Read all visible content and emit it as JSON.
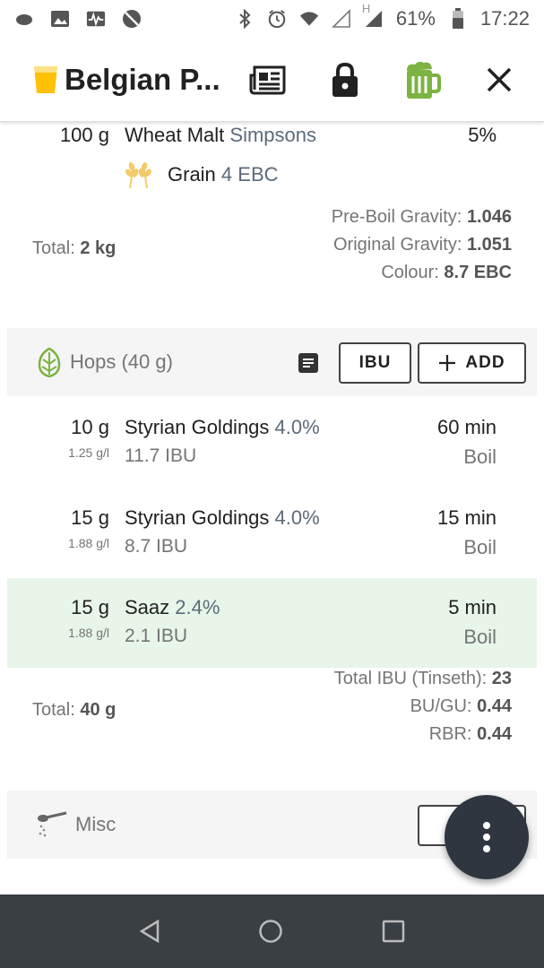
{
  "status_bar": {
    "battery": "61%",
    "time": "17:22",
    "network_h": "H",
    "icons_left": [
      "cloud-icon",
      "image-icon",
      "activity-icon",
      "no-sync-icon"
    ],
    "icons_right": [
      "bluetooth-icon",
      "alarm-icon",
      "wifi-icon",
      "signal-empty-icon",
      "signal-icon",
      "battery-icon"
    ]
  },
  "toolbar": {
    "title": "Belgian P...",
    "icons": [
      "beer-glass-icon",
      "newspaper-icon",
      "lock-icon",
      "beer-mug-icon",
      "close-icon"
    ]
  },
  "fermentables": {
    "last_item": {
      "quantity": "100 g",
      "name": "Wheat Malt",
      "supplier": "Simpsons",
      "percent": "5%",
      "type": "Grain",
      "colour": "4 EBC"
    },
    "total_label": "Total:",
    "total_value": "2 kg",
    "stats": [
      {
        "label": "Pre-Boil Gravity:",
        "value": "1.046"
      },
      {
        "label": "Original Gravity:",
        "value": "1.051"
      },
      {
        "label": "Colour:",
        "value": "8.7 EBC"
      }
    ]
  },
  "hops": {
    "header": "Hops (40 g)",
    "ibu_button": "IBU",
    "add_button": "ADD",
    "items": [
      {
        "quantity": "10 g",
        "concentration": "1.25 g/l",
        "name": "Styrian Goldings",
        "alpha": "4.0%",
        "ibu": "11.7 IBU",
        "time": "60 min",
        "use": "Boil"
      },
      {
        "quantity": "15 g",
        "concentration": "1.88 g/l",
        "name": "Styrian Goldings",
        "alpha": "4.0%",
        "ibu": "8.7 IBU",
        "time": "15 min",
        "use": "Boil"
      },
      {
        "quantity": "15 g",
        "concentration": "1.88 g/l",
        "name": "Saaz",
        "alpha": "2.4%",
        "ibu": "2.1 IBU",
        "time": "5 min",
        "use": "Boil"
      }
    ],
    "total_label": "Total:",
    "total_value": "40 g",
    "stats": [
      {
        "label": "Total IBU (Tinseth):",
        "value": "23"
      },
      {
        "label": "BU/GU:",
        "value": "0.44"
      },
      {
        "label": "RBR:",
        "value": "0.44"
      }
    ]
  },
  "misc": {
    "header": "Misc"
  },
  "colors": {
    "accent_green": "#7cb342",
    "highlight_row": "#e8f5e9",
    "fab": "#2f3640",
    "navbar": "#3a3f44"
  }
}
